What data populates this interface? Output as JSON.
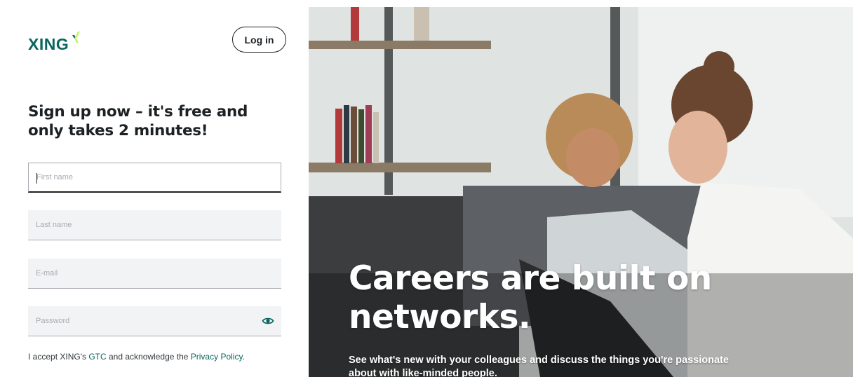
{
  "header": {
    "logo_text": "XING",
    "login_label": "Log in"
  },
  "signup": {
    "headline": "Sign up now – it's free and only takes 2 minutes!",
    "fields": {
      "first_name": {
        "placeholder": "First name",
        "value": ""
      },
      "last_name": {
        "placeholder": "Last name",
        "value": ""
      },
      "email": {
        "placeholder": "E-mail",
        "value": ""
      },
      "password": {
        "placeholder": "Password",
        "value": ""
      }
    },
    "legal": {
      "prefix": "I accept XING's ",
      "gtc_link": "GTC",
      "middle": " and acknowledge the ",
      "privacy_link": "Privacy Policy",
      "suffix": "."
    }
  },
  "hero": {
    "title": "Careers are built on networks.",
    "subtitle": "See what's new with your colleagues and discuss the things you're passionate about with like-minded people."
  },
  "icons": {
    "logo": "xing-logo-icon",
    "password_toggle": "eye-icon"
  },
  "colors": {
    "brand": "#0a6660",
    "accent_lime": "#c6f16d",
    "text": "#1d2124",
    "field_bg": "#f2f3f5"
  }
}
